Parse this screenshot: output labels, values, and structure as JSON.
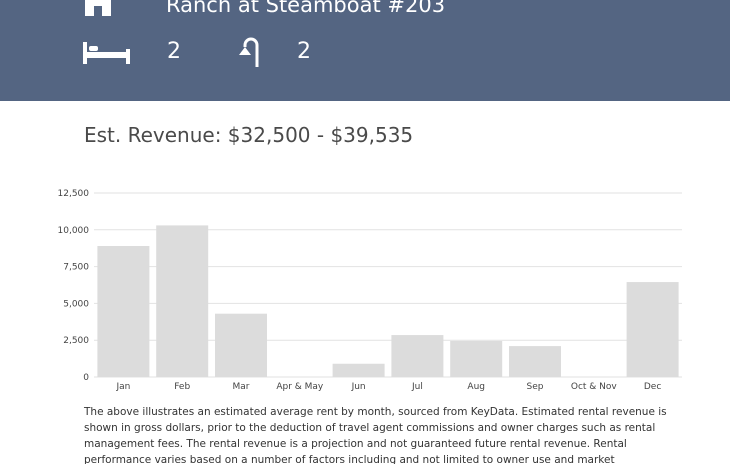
{
  "header": {
    "title": "Ranch at Steamboat #203",
    "bedrooms": "2",
    "bathrooms": "2",
    "bg_color": "#546582",
    "icons": {
      "home": "home-icon",
      "bed": "bed-icon",
      "bath": "shower-icon"
    }
  },
  "revenue": {
    "text": "Est. Revenue: $32,500 - $39,535"
  },
  "chart_data": {
    "type": "bar",
    "categories": [
      "Jan",
      "Feb",
      "Mar",
      "Apr & May",
      "Jun",
      "Jul",
      "Aug",
      "Sep",
      "Oct & Nov",
      "Dec"
    ],
    "values": [
      8900,
      10300,
      4300,
      0,
      900,
      2850,
      2450,
      2100,
      0,
      6450
    ],
    "ytick_labels": [
      "0",
      "2,500",
      "5,000",
      "7,500",
      "10,000",
      "12,500"
    ],
    "ytick_values": [
      0,
      2500,
      5000,
      7500,
      10000,
      12500
    ],
    "ylim": [
      0,
      12500
    ],
    "grid": true,
    "bar_color": "#dcdcdc",
    "title": "",
    "xlabel": "",
    "ylabel": ""
  },
  "description": {
    "text": "The above illustrates an estimated average rent by month, sourced from KeyData. Estimated rental revenue is shown in gross dollars, prior to the deduction of travel agent commissions and owner charges such as rental management fees. The rental revenue is a projection and not guaranteed future rental revenue. Rental performance varies based on a number of factors including and not limited to owner use and market"
  }
}
